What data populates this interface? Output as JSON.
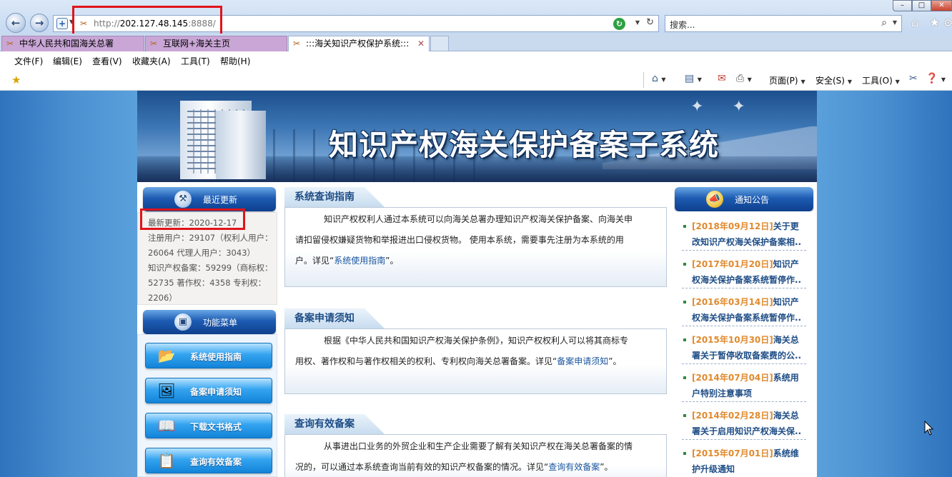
{
  "browser": {
    "address": {
      "url_prefix": "http://",
      "url_host": "202.127.48.145",
      "url_suffix": ":8888/"
    },
    "search": {
      "placeholder": "搜索..."
    },
    "tabs": [
      {
        "label": "中华人民共和国海关总署"
      },
      {
        "label": "互联网+海关主页"
      },
      {
        "label": ":::海关知识产权保护系统:::"
      }
    ],
    "menu": [
      "文件(F)",
      "编辑(E)",
      "查看(V)",
      "收藏夹(A)",
      "工具(T)",
      "帮助(H)"
    ],
    "commands": {
      "page": "页面(P)",
      "safety": "安全(S)",
      "tools": "工具(O)"
    }
  },
  "site": {
    "title": "知识产权海关保护备案子系统",
    "recent": {
      "header": "最近更新",
      "latest": "最新更新：2020-12-17",
      "lines": [
        "注册用户：29107（权利人用户：",
        "26064 代理人用户：3043）",
        "知识产权备案：59299（商标权：",
        "52735 著作权：4358 专利权：",
        "2206）"
      ]
    },
    "function_menu": {
      "header": "功能菜单",
      "buttons": [
        "系统使用指南",
        "备案申请须知",
        "下载文书格式",
        "查询有效备案"
      ]
    },
    "sections": [
      {
        "title": "系统查询指南",
        "lines": [
          "知识产权权利人通过本系统可以向海关总署办理知识产权海关保护备案、向海关申",
          "请扣留侵权嫌疑货物和举报进出口侵权货物。 使用本系统，需要事先注册为本系统的用",
          "户。详见“"
        ],
        "link": "系统使用指南",
        "tail": "”。"
      },
      {
        "title": "备案申请须知",
        "lines": [
          "根据《中华人民共和国知识产权海关保护条例》，知识产权权利人可以将其商标专",
          "用权、著作权和与著作权相关的权利、专利权向海关总署备案。详见“"
        ],
        "link": "备案申请须知",
        "tail": "”。"
      },
      {
        "title": "查询有效备案",
        "lines": [
          "从事进出口业务的外贸企业和生产企业需要了解有关知识产权在海关总署备案的情",
          "况的，可以通过本系统查询当前有效的知识产权备案的情况。详见“"
        ],
        "link": "查询有效备案",
        "tail": "”。"
      }
    ],
    "notices": {
      "header": "通知公告",
      "items": [
        {
          "date": "[2018年09月12日]",
          "text": "关于更改知识产权海关保护备案相.."
        },
        {
          "date": "[2017年01月20日]",
          "text": "知识产权海关保护备案系统暂停作.."
        },
        {
          "date": "[2016年03月14日]",
          "text": "知识产权海关保护备案系统暂停作.."
        },
        {
          "date": "[2015年10月30日]",
          "text": "海关总署关于暂停收取备案费的公.."
        },
        {
          "date": "[2014年07月04日]",
          "text": "系统用户特别注意事项"
        },
        {
          "date": "[2014年02月28日]",
          "text": "海关总署关于启用知识产权海关保.."
        },
        {
          "date": "[2015年07月01日]",
          "text": "系统维护升级通知"
        }
      ]
    }
  }
}
